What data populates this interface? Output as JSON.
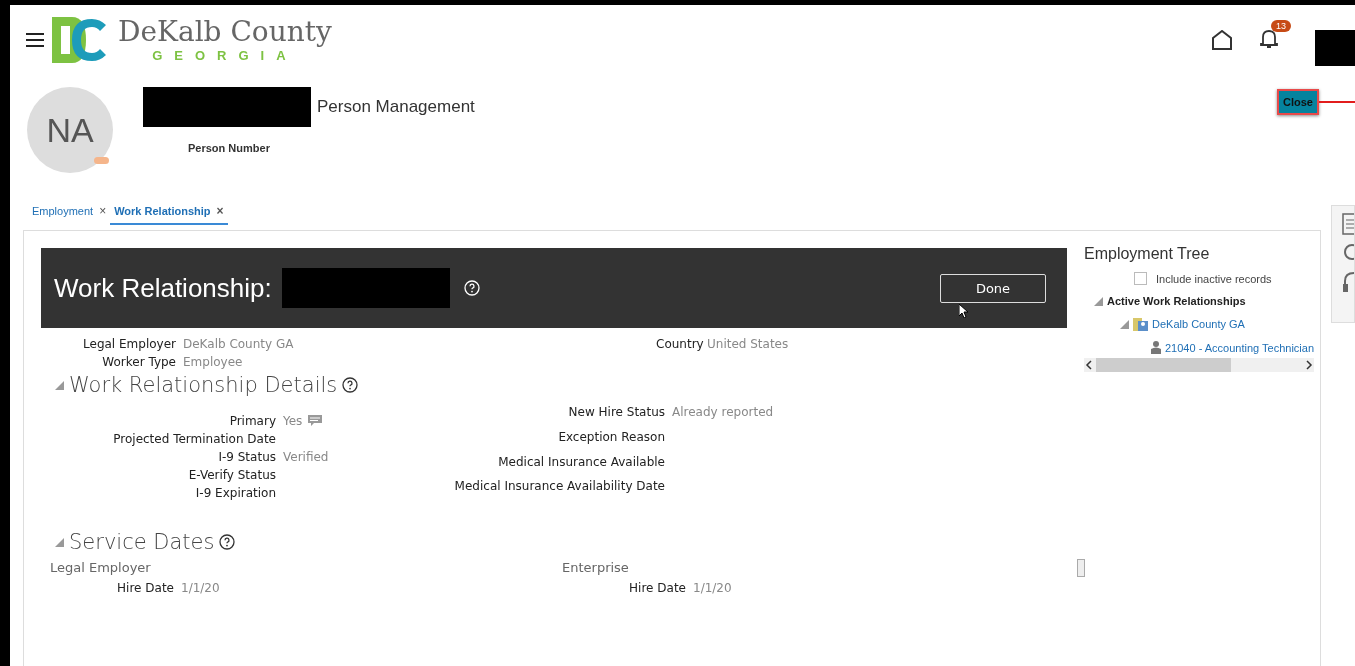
{
  "header": {
    "logo_name": "DeKalb County",
    "logo_state": "GEORGIA",
    "notification_count": "13"
  },
  "person": {
    "initials": "NA",
    "title": "Person Management",
    "number_label": "Person Number",
    "close_button": "Close"
  },
  "tabs": [
    {
      "label": "Employment",
      "close": "×",
      "selected": false
    },
    {
      "label": "Work Relationship",
      "close": "×",
      "selected": true
    }
  ],
  "work_relationship": {
    "title": "Work Relationship:",
    "done_button": "Done",
    "summary_left": [
      {
        "label": "Legal Employer",
        "value": "DeKalb County GA"
      },
      {
        "label": "Worker Type",
        "value": "Employee"
      }
    ],
    "summary_right": [
      {
        "label": "Country",
        "value": "United States"
      }
    ]
  },
  "details": {
    "title": "Work Relationship Details",
    "expanded": true,
    "left": [
      {
        "label": "Primary",
        "value": "Yes",
        "kind": "with-icon"
      },
      {
        "label": "Projected Termination Date"
      },
      {
        "label": "I-9 Status",
        "value": "Verified"
      },
      {
        "label": "E-Verify Status"
      },
      {
        "label": "I-9 Expiration"
      }
    ],
    "right": [
      {
        "label": "New Hire Status",
        "value": "Already reported"
      },
      {
        "label": "Exception Reason"
      },
      {
        "label": "Medical Insurance Available"
      },
      {
        "label": "Medical Insurance Availability Date"
      }
    ]
  },
  "service_dates": {
    "title": "Service Dates",
    "expanded": true,
    "groups": [
      {
        "heading": "Legal Employer",
        "fields": [
          {
            "label": "Hire Date",
            "value": "1/1/20"
          }
        ]
      },
      {
        "heading": "Enterprise",
        "fields": [
          {
            "label": "Hire Date",
            "value": "1/1/20"
          }
        ]
      }
    ]
  },
  "employment_tree": {
    "title": "Employment Tree",
    "include_inactive": {
      "label": "Include inactive records",
      "checked": false
    },
    "nodes": [
      {
        "label": "Active Work Relationships",
        "kind": "group",
        "expanded": true,
        "children": [
          {
            "label": "DeKalb County GA",
            "kind": "employer",
            "expanded": true,
            "children": [
              {
                "label": "21040 - Accounting Technician",
                "kind": "assignment"
              }
            ]
          }
        ]
      }
    ]
  }
}
